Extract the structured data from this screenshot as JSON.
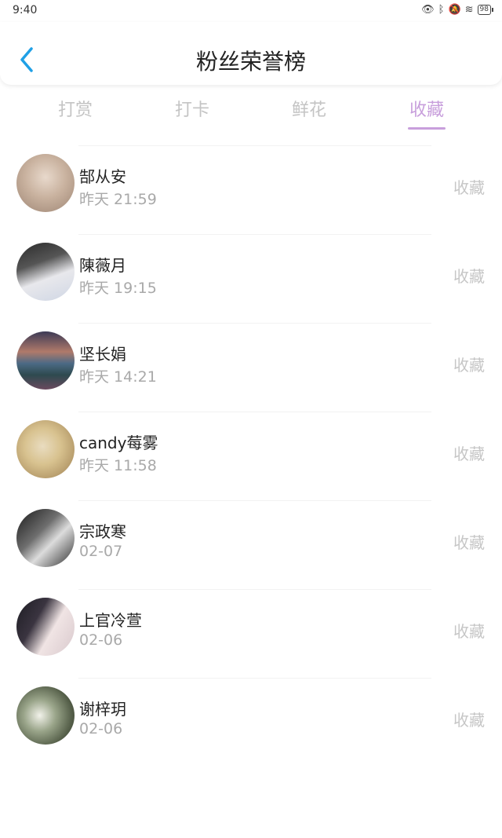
{
  "status": {
    "time": "9:40",
    "battery": "98"
  },
  "header": {
    "title": "粉丝荣誉榜"
  },
  "tabs": [
    {
      "label": "打赏",
      "active": false
    },
    {
      "label": "打卡",
      "active": false
    },
    {
      "label": "鲜花",
      "active": false
    },
    {
      "label": "收藏",
      "active": true
    }
  ],
  "colors": {
    "accent": "#c89fdc",
    "back": "#1fa0e6"
  },
  "list": [
    {
      "name": "郜从安",
      "time": "昨天 21:59",
      "action": "收藏"
    },
    {
      "name": "陳薇月",
      "time": "昨天 19:15",
      "action": "收藏"
    },
    {
      "name": "坚长娟",
      "time": "昨天 14:21",
      "action": "收藏"
    },
    {
      "name": "candy莓雾",
      "time": "昨天 11:58",
      "action": "收藏"
    },
    {
      "name": "宗政寒",
      "time": "02-07",
      "action": "收藏"
    },
    {
      "name": "上官冷萱",
      "time": "02-06",
      "action": "收藏"
    },
    {
      "name": "谢梓玥",
      "time": "02-06",
      "action": "收藏"
    }
  ]
}
